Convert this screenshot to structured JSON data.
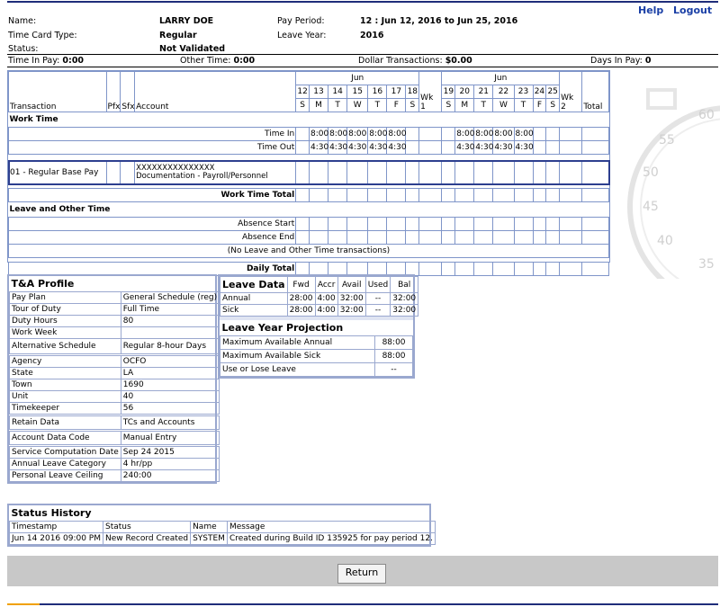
{
  "links": {
    "help": "Help",
    "logout": "Logout"
  },
  "header": {
    "name_label": "Name:",
    "name": "LARRY DOE",
    "pay_period_label": "Pay Period:",
    "pay_period": "12 : Jun 12, 2016 to Jun 25, 2016",
    "tct_label": "Time Card Type:",
    "tct": "Regular",
    "leave_year_label": "Leave Year:",
    "leave_year": "2016",
    "status_label": "Status:",
    "status": "Not Validated",
    "time_in_pay_label": "Time In Pay:",
    "time_in_pay": "0:00",
    "other_time_label": "Other Time:",
    "other_time": "0:00",
    "dollar_label": "Dollar Transactions:",
    "dollar": "$0.00",
    "days_label": "Days In Pay:",
    "days": "0"
  },
  "grid": {
    "month": "Jun",
    "col_transaction": "Transaction",
    "col_pfx": "Pfx",
    "col_sfx": "Sfx",
    "col_account": "Account",
    "week1_days": [
      "12",
      "13",
      "14",
      "15",
      "16",
      "17",
      "18"
    ],
    "week1_dow": [
      "S",
      "M",
      "T",
      "W",
      "T",
      "F",
      "S"
    ],
    "week2_days": [
      "19",
      "20",
      "21",
      "22",
      "23",
      "24",
      "25"
    ],
    "week2_dow": [
      "S",
      "M",
      "T",
      "W",
      "T",
      "F",
      "S"
    ],
    "wk1": "Wk 1",
    "wk2": "Wk 2",
    "total": "Total",
    "work_time": "Work Time",
    "time_in_label": "Time In",
    "time_out_label": "Time Out",
    "time_in_w1": [
      "8:00",
      "8:00",
      "8:00",
      "8:00",
      "8:00"
    ],
    "time_out_w1": [
      "4:30",
      "4:30",
      "4:30",
      "4:30",
      "4:30"
    ],
    "time_in_w2": [
      "8:00",
      "8:00",
      "8:00",
      "8:00"
    ],
    "time_out_w2": [
      "4:30",
      "4:30",
      "4:30",
      "4:30"
    ],
    "transaction": "01 - Regular Base Pay",
    "account_code": "XXXXXXXXXXXXXXX",
    "account_desc": "Documentation - Payroll/Personnel",
    "work_total": "Work Time Total",
    "leave_other": "Leave and Other Time",
    "absence_start": "Absence Start",
    "absence_end": "Absence End",
    "no_leave": "(No Leave and Other Time transactions)",
    "daily_total": "Daily Total"
  },
  "profile": {
    "title": "T&A Profile",
    "rows": [
      [
        "Pay Plan",
        "General Schedule (reg)"
      ],
      [
        "Tour of Duty",
        "Full Time"
      ],
      [
        "Duty Hours",
        "80"
      ],
      [
        "Work Week",
        ""
      ],
      [
        "Alternative Schedule",
        "Regular 8-hour Days"
      ],
      [
        "Agency",
        "OCFO"
      ],
      [
        "State",
        "LA"
      ],
      [
        "Town",
        "1690"
      ],
      [
        "Unit",
        "40"
      ],
      [
        "Timekeeper",
        "56"
      ],
      [
        "Retain Data",
        "TCs and Accounts"
      ],
      [
        "Account Data Code",
        "Manual Entry"
      ],
      [
        "Service Computation Date",
        "Sep 24 2015"
      ],
      [
        "Annual Leave Category",
        "4 hr/pp"
      ],
      [
        "Personal Leave Ceiling",
        "240:00"
      ]
    ]
  },
  "leave": {
    "title": "Leave Data",
    "cols": [
      "Fwd",
      "Accr",
      "Avail",
      "Used",
      "Bal"
    ],
    "rows": [
      [
        "Annual",
        "28:00",
        "4:00",
        "32:00",
        "--",
        "32:00"
      ],
      [
        "Sick",
        "28:00",
        "4:00",
        "32:00",
        "--",
        "32:00"
      ]
    ],
    "proj_title": "Leave Year Projection",
    "proj": [
      [
        "Maximum Available Annual",
        "88:00"
      ],
      [
        "Maximum Available Sick",
        "88:00"
      ],
      [
        "Use or Lose Leave",
        "--"
      ]
    ]
  },
  "history": {
    "title": "Status History",
    "cols": [
      "Timestamp",
      "Status",
      "Name",
      "Message"
    ],
    "row": [
      "Jun 14 2016 09:00 PM",
      "New Record Created",
      "SYSTEM",
      "Created during Build ID 135925 for pay period 12."
    ]
  },
  "footer": {
    "return": "Return"
  },
  "watch": {
    "n60": "60",
    "n55": "55",
    "n50": "50",
    "n45": "45",
    "n40": "40",
    "n35": "35"
  },
  "colors": {
    "border": "#7f95c9",
    "accent": "#1f2d7a",
    "footer": "#c8c8c8"
  }
}
